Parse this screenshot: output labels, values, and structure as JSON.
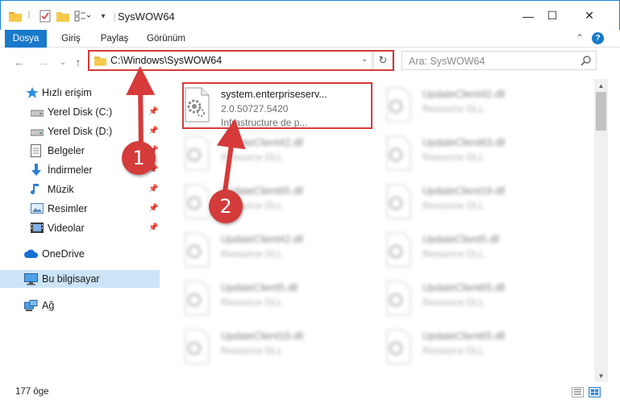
{
  "window": {
    "title": "SysWOW64",
    "minimize_glyph": "—",
    "maximize_glyph": "☐",
    "close_glyph": "✕"
  },
  "ribbon": {
    "tabs": [
      {
        "label": "Dosya"
      },
      {
        "label": "Giriş"
      },
      {
        "label": "Paylaş"
      },
      {
        "label": "Görünüm"
      }
    ],
    "collapse_glyph": "⌃",
    "help_glyph": "?"
  },
  "navigation": {
    "back_glyph": "←",
    "forward_glyph": "→",
    "recent_glyph": "⌄",
    "up_glyph": "↑",
    "address": "C:\\Windows\\SysWOW64",
    "address_dropdown_glyph": "⌄",
    "refresh_glyph": "↻",
    "search_placeholder": "Ara: SysWOW64"
  },
  "sidebar": {
    "items": [
      {
        "label": "Hızlı erişim",
        "icon": "star-icon"
      },
      {
        "label": "Yerel Disk (C:)",
        "icon": "drive-icon",
        "pin": "📌"
      },
      {
        "label": "Yerel Disk (D:)",
        "icon": "drive-icon",
        "pin": "📌"
      },
      {
        "label": "Belgeler",
        "icon": "documents-icon",
        "pin": "📌"
      },
      {
        "label": "İndirmeler",
        "icon": "downloads-icon",
        "pin": "📌"
      },
      {
        "label": "Müzik",
        "icon": "music-icon",
        "pin": "📌"
      },
      {
        "label": "Resimler",
        "icon": "pictures-icon",
        "pin": "📌"
      },
      {
        "label": "Videolar",
        "icon": "videos-icon",
        "pin": "📌"
      },
      {
        "label": "OneDrive",
        "icon": "cloud-icon"
      },
      {
        "label": "Bu bilgisayar",
        "icon": "computer-icon",
        "selected": true
      },
      {
        "label": "Ağ",
        "icon": "network-icon"
      }
    ]
  },
  "files": [
    {
      "name": "system.enterpriseserv...",
      "line2": "2.0.50727.5420",
      "line3": "Infrastructure de p..."
    },
    {
      "name": "UpdateClient42.dll",
      "line2": "Resource DLL"
    },
    {
      "name": "UpdateClient42.dll",
      "line2": "Resource DLL"
    },
    {
      "name": "UpdateClient63.dll",
      "line2": "Resource DLL"
    },
    {
      "name": "UpdateClient65.dll",
      "line2": "Resource DLL"
    },
    {
      "name": "UpdateClient19.dll",
      "line2": "Resource DLL"
    },
    {
      "name": "UpdateClient42.dll",
      "line2": "Resource DLL"
    },
    {
      "name": "UpdateClient5.dll",
      "line2": "Resource DLL"
    },
    {
      "name": "UpdateClient5.dll",
      "line2": "Resource DLL"
    },
    {
      "name": "UpdateClient65.dll",
      "line2": "Resource DLL"
    },
    {
      "name": "UpdateClient19.dll",
      "line2": "Resource DLL"
    },
    {
      "name": "UpdateClient65.dll",
      "line2": "Resource DLL"
    }
  ],
  "status": {
    "item_count": "177 öge"
  },
  "annotations": {
    "step1": "1",
    "step2": "2",
    "highlight_color": "#d63a3a"
  },
  "colors": {
    "accent": "#1979ca",
    "selection": "#cce4f7",
    "folder": "#f6c94a"
  }
}
